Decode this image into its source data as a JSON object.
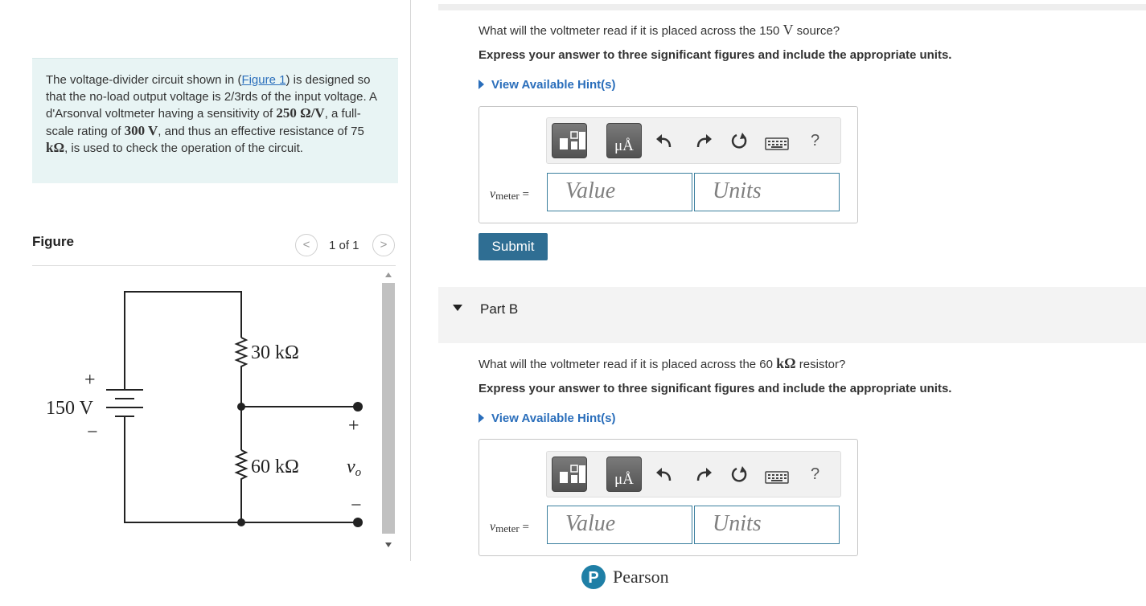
{
  "intro": {
    "text_part1": "The voltage-divider circuit shown in (",
    "figure_link": "Figure 1",
    "text_part2": ") is designed so that the no-load output voltage is 2/3rds of the input voltage. A d'Arsonval voltmeter having a sensitivity of ",
    "sensitivity": "250 Ω/V",
    "text_part3": ", a full-scale rating of ",
    "full_scale": "300 V",
    "text_part4": ", and thus an effective resistance of 75 ",
    "resistance_unit": "kΩ",
    "text_part5": ", is used to check the operation of the circuit."
  },
  "figure": {
    "title": "Figure",
    "pager_label": "1 of 1",
    "prev_glyph": "<",
    "next_glyph": ">",
    "circuit": {
      "r1": "30 kΩ",
      "r2": "60 kΩ",
      "source": "150 V",
      "plus": "+",
      "minus": "−",
      "out_plus": "+",
      "out_minus": "−",
      "vo_symbol": "v",
      "vo_sub": "o"
    }
  },
  "partA": {
    "q_prefix": "What will the voltmeter read if it is placed across the 150 ",
    "q_unit": "V",
    "q_suffix": " source?",
    "instructions": "Express your answer to three significant figures and include the appropriate units.",
    "hint": "View Available Hint(s)",
    "var_symbol": "v",
    "var_sub": "meter",
    "equals": "=",
    "value_placeholder": "Value",
    "units_placeholder": "Units",
    "submit": "Submit"
  },
  "partB": {
    "title": "Part B",
    "q_prefix": "What will the voltmeter read if it is placed across the 60 ",
    "q_unit": "kΩ",
    "q_suffix": " resistor?",
    "instructions": "Express your answer to three significant figures and include the appropriate units.",
    "hint": "View Available Hint(s)",
    "var_symbol": "v",
    "var_sub": "meter",
    "equals": "=",
    "value_placeholder": "Value",
    "units_placeholder": "Units"
  },
  "toolbar": {
    "units_btn_label": "μÅ",
    "help_label": "?",
    "icons": [
      "templates-icon",
      "units-icon",
      "undo-icon",
      "redo-icon",
      "reset-icon",
      "keyboard-icon",
      "help-icon"
    ]
  },
  "footer": {
    "brand": "Pearson",
    "brand_logo_letter": "P"
  },
  "colors": {
    "accent": "#2a6ebb",
    "submit": "#2f6e93",
    "intro_bg": "#e8f4f4",
    "field_border": "#3b7f9e"
  }
}
